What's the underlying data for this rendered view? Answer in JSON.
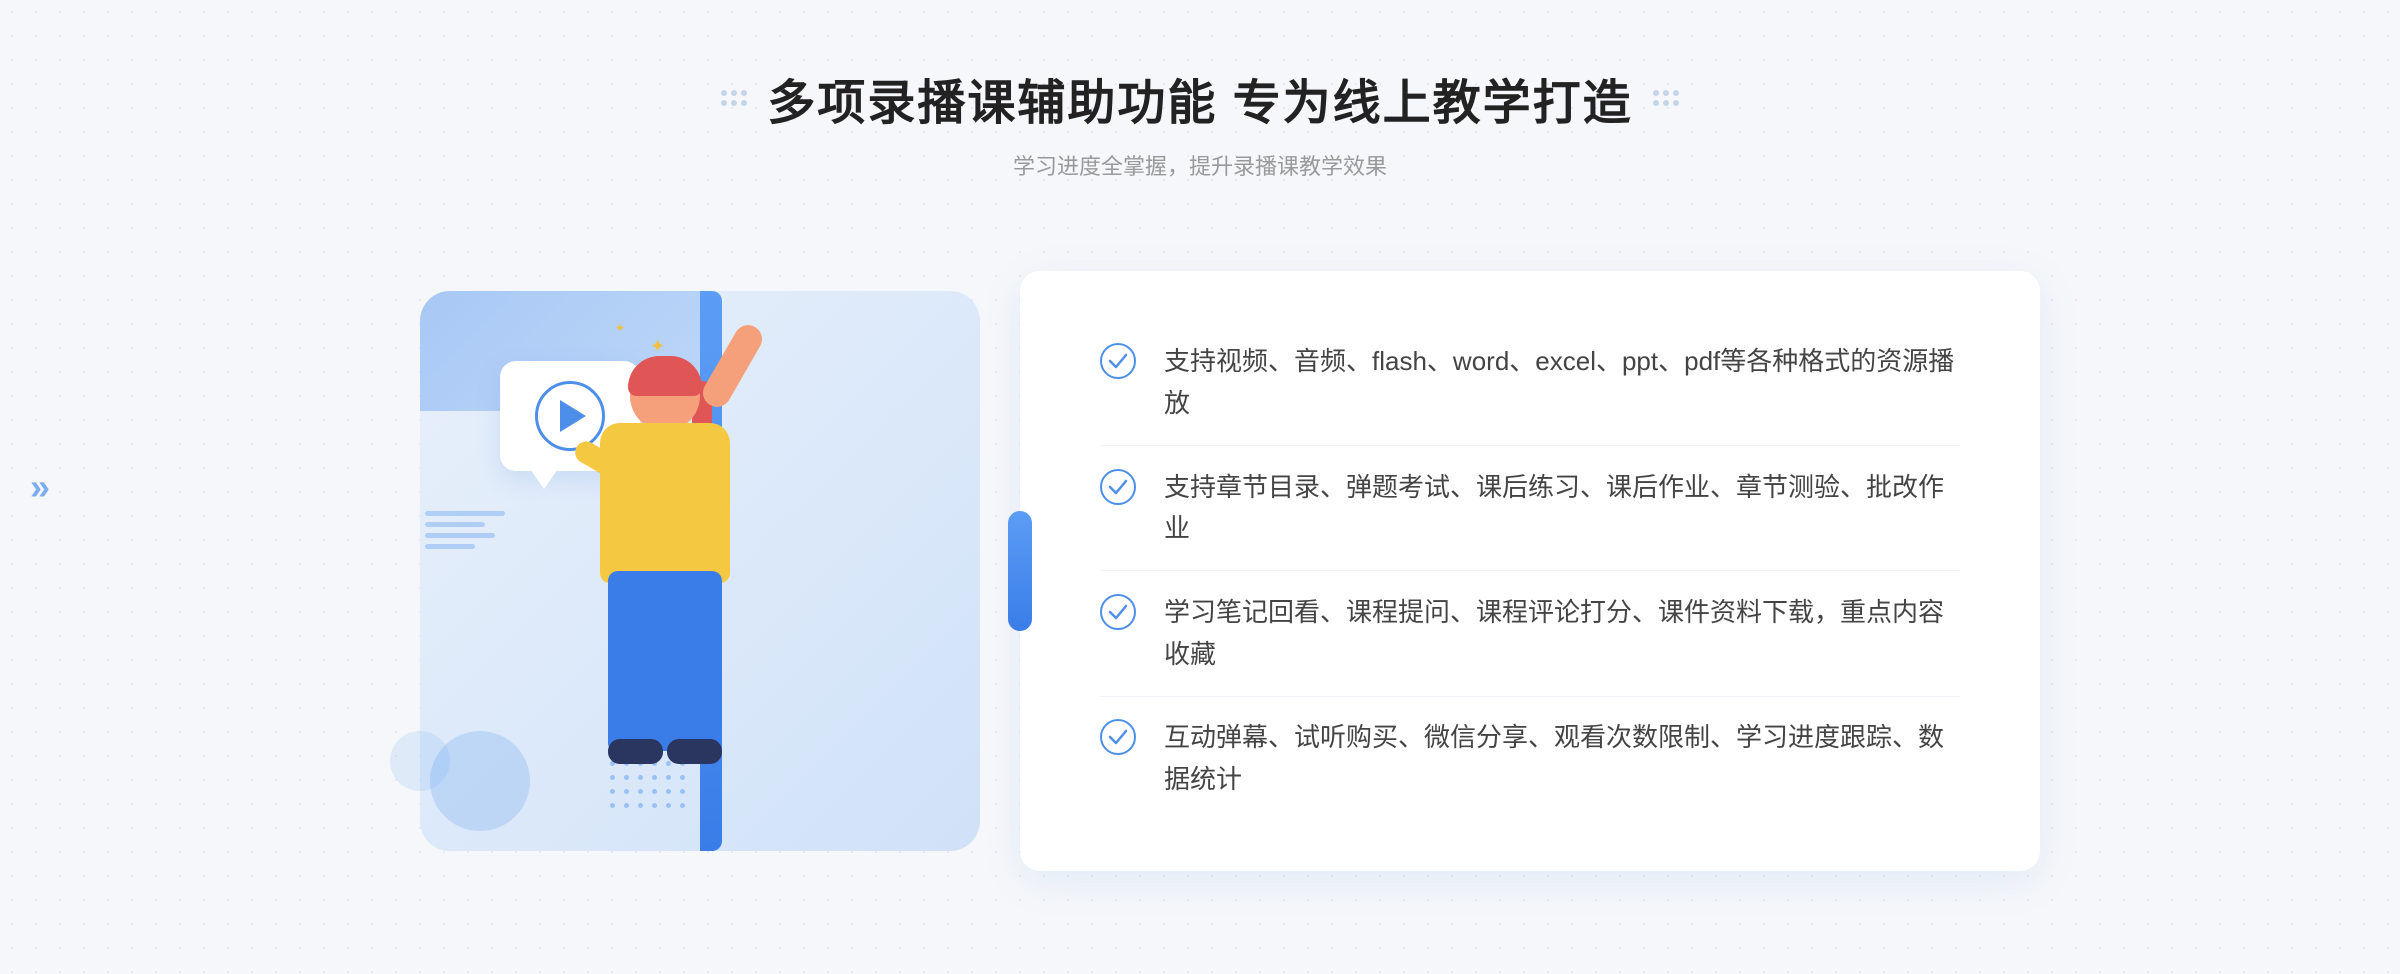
{
  "header": {
    "title": "多项录播课辅助功能 专为线上教学打造",
    "subtitle": "学习进度全掌握，提升录播课教学效果",
    "decoration_dots": 6
  },
  "features": [
    {
      "id": 1,
      "text": "支持视频、音频、flash、word、excel、ppt、pdf等各种格式的资源播放"
    },
    {
      "id": 2,
      "text": "支持章节目录、弹题考试、课后练习、课后作业、章节测验、批改作业"
    },
    {
      "id": 3,
      "text": "学习笔记回看、课程提问、课程评论打分、课件资料下载，重点内容收藏"
    },
    {
      "id": 4,
      "text": "互动弹幕、试听购买、微信分享、观看次数限制、学习进度跟踪、数据统计"
    }
  ],
  "colors": {
    "primary_blue": "#4d8fe8",
    "light_blue": "#a8c8f5",
    "title_color": "#222222",
    "subtitle_color": "#999999",
    "text_color": "#444444",
    "bg_color": "#f5f7fa",
    "check_color": "#4d8fe8"
  }
}
